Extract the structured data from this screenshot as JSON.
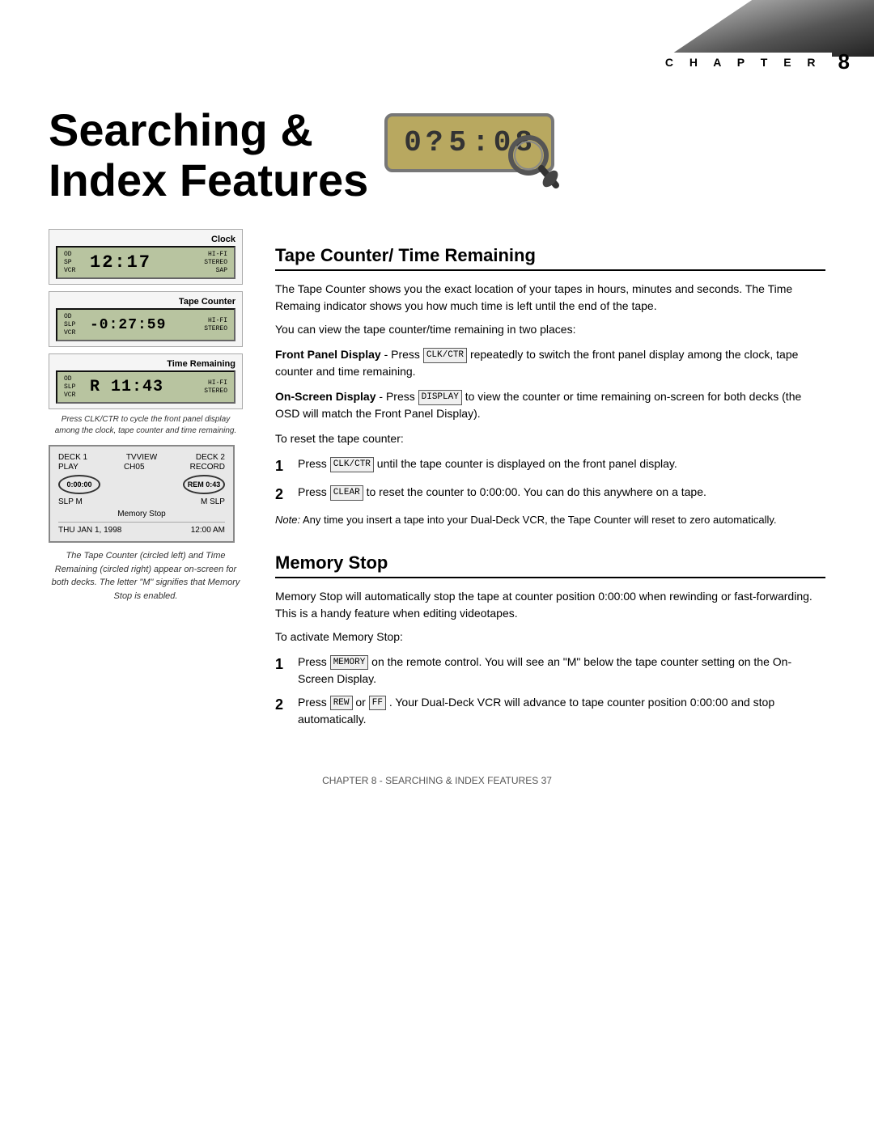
{
  "chapter": {
    "label": "C H A P T E R",
    "number": "8"
  },
  "title": {
    "line1": "Searching &",
    "line2": "Index Features",
    "lcd_display": "0?5:08"
  },
  "left_column": {
    "panel1": {
      "title": "Clock",
      "left_top": "OD",
      "left_mid": "SP",
      "left_bot": "VCR",
      "digits": "12:17",
      "right_top": "HI-FI",
      "right_mid": "STEREO",
      "right_bot": "SAP"
    },
    "panel2": {
      "title": "Tape Counter",
      "left_top": "OD",
      "left_mid": "SLP",
      "left_bot": "VCR",
      "digits": "-0:27:59",
      "right_top": "HI-FI",
      "right_mid": "STEREO",
      "right_bot": ""
    },
    "panel3": {
      "title": "Time Remaining",
      "left_top": "OD",
      "left_mid": "SLP",
      "left_bot": "VCR",
      "digits": "R 11:43",
      "right_top": "HI-FI",
      "right_mid": "STEREO",
      "right_bot": ""
    },
    "caption1": "Press CLK/CTR to cycle the front panel display among the clock, tape counter and time remaining.",
    "osd_panel": {
      "deck1_label": "DECK 1",
      "tvview_label": "TVVIEW",
      "deck2_label": "DECK 2",
      "deck1_status": "PLAY",
      "ch_label": "CH05",
      "deck2_status": "RECORD",
      "deck1_counter": "0:00:00",
      "rem_label": "REM 0:43",
      "deck1_mode": "SLP M",
      "deck2_mode": "M SLP",
      "memory_stop_label": "Memory Stop",
      "date_label": "THU JAN 1, 1998",
      "time_label": "12:00 AM"
    },
    "caption2": "The Tape Counter (circled left) and Time Remaining (circled right) appear on-screen for both decks. The letter \"M\" signifies that Memory Stop is enabled."
  },
  "right_column": {
    "section1": {
      "heading": "Tape Counter/ Time Remaining",
      "intro": "The Tape Counter shows you the exact location of your tapes in hours, minutes and seconds. The Time Remaing indicator shows you how much time is left until the end of the tape.",
      "view_locations": "You can view the tape counter/time remaining in two places:",
      "front_panel_bold": "Front Panel Display",
      "front_panel_text": "- Press CLK/CTR repeatedly to switch the front panel display among the clock, tape counter and time remaining.",
      "onscreen_bold": "On-Screen Display",
      "onscreen_text": "- Press DISPLAY to view the counter or time remaining on-screen for both decks (the OSD will match the Front Panel Display).",
      "reset_intro": "To reset the tape counter:",
      "step1": "Press CLK/CTR until the tape counter is displayed on the front panel display.",
      "step2_start": "Press ",
      "step2_btn": "CLEAR",
      "step2_end": " to reset the counter to 0:00:00. You can do this anywhere on a tape.",
      "note_label": "Note:",
      "note_text": "Any time you insert a tape into your Dual-Deck VCR, the Tape Counter will reset to zero automatically."
    },
    "section2": {
      "heading": "Memory Stop",
      "intro": "Memory Stop will automatically stop the tape at counter position 0:00:00 when rewinding or fast-forwarding. This is a handy feature when editing videotapes.",
      "activate_intro": "To activate Memory Stop:",
      "step1": "Press MEMORY on the remote control. You will see an \"M\" below the tape counter setting on the On-Screen Display.",
      "step2": "Press REW or FF . Your Dual-Deck VCR will advance to tape counter position 0:00:00 and stop automatically."
    }
  },
  "footer": {
    "text": "CHAPTER 8 - SEARCHING & INDEX FEATURES  37"
  }
}
